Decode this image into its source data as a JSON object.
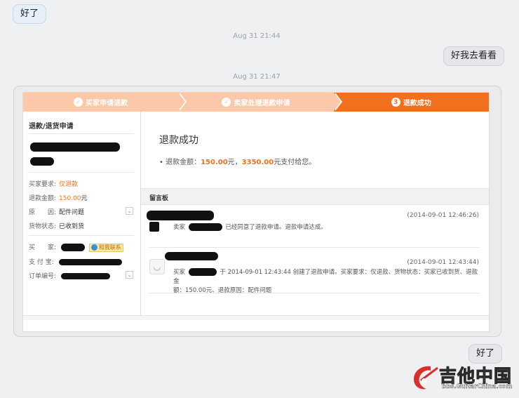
{
  "chat": {
    "msg1": "好了",
    "ts1": "Aug 31  21:44",
    "msg2": "好我去看看",
    "ts2": "Aug 31  21:47",
    "msg3": "好了"
  },
  "steps": [
    {
      "label": "买家申请退款",
      "icon": "check-icon"
    },
    {
      "label": "卖家处理退款申请",
      "icon": "check-icon"
    },
    {
      "label": "退款成功",
      "icon": "3"
    }
  ],
  "left_panel": {
    "title": "退款/退货申请",
    "buyer_request_label": "买家要求:",
    "buyer_request_value": "仅退款",
    "refund_amount_label": "退款金额:",
    "refund_amount_value": "150.00",
    "refund_amount_unit": "元",
    "reason_label": "原　　因:",
    "reason_value": "配件问题",
    "goods_status_label": "货物状态:",
    "goods_status_value": "已收到货",
    "buyer_label": "买　　家:",
    "contact_label": "和我联系",
    "alipay_label": "支 付 宝:",
    "order_no_label": "订单编号:"
  },
  "right_panel": {
    "title": "退款成功",
    "line_prefix": "• 退款金额：",
    "amount1": "150.00",
    "mid": "元，",
    "amount2": "3350.00",
    "suffix": "元支付给您。",
    "board_title": "留言板",
    "messages": [
      {
        "date": "(2014-09-01 12:46:26)",
        "role": "卖家",
        "text": "已经同意了退款申请。退款申请达成。"
      },
      {
        "date": "(2014-09-01 12:43:44)",
        "role": "买家",
        "text1": "于 2014-09-01 12:43:44 创建了退款申请。买家要求：仅退款、货物状态：买家已收到货、退款金",
        "text2": "额：150.00元、退款原因：配件问题"
      }
    ]
  },
  "watermark": {
    "title": "吉他中国",
    "url": "bbs.GuitarChina.com"
  },
  "colors": {
    "accent": "#f1701e",
    "step_done": "#fbc9a9",
    "incoming_bubble": "#e7f0fa",
    "outgoing_bubble": "#e5e7ea"
  }
}
